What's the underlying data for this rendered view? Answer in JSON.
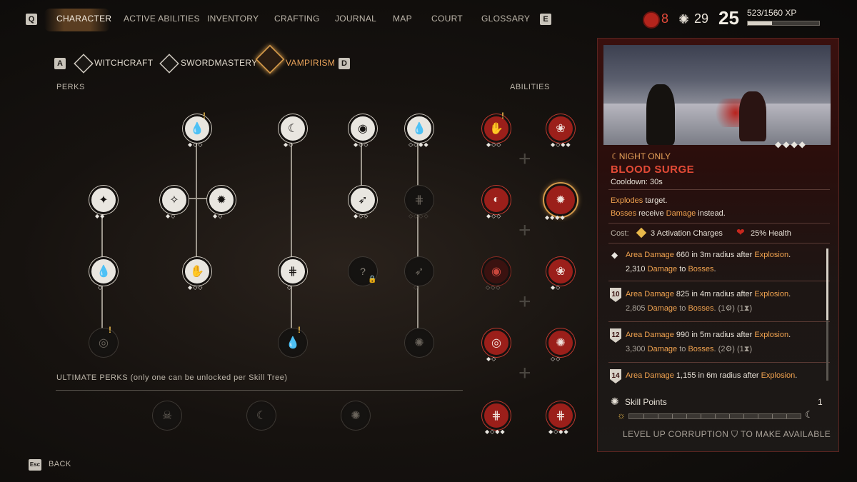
{
  "nav": {
    "left_key": "Q",
    "right_key": "E",
    "tabs": [
      {
        "label": "CHARACTER"
      },
      {
        "label": "ACTIVE ABILITIES"
      },
      {
        "label": "INVENTORY"
      },
      {
        "label": "CRAFTING"
      },
      {
        "label": "JOURNAL"
      },
      {
        "label": "MAP"
      },
      {
        "label": "COURT"
      },
      {
        "label": "GLOSSARY"
      }
    ],
    "active_tab": "CHARACTER"
  },
  "stats": {
    "blood": "8",
    "corruption": "29",
    "level": "25",
    "xp": "523/1560 XP",
    "xp_fraction": 0.335
  },
  "trees": {
    "left_key": "A",
    "right_key": "D",
    "tabs": [
      {
        "label": "WITCHCRAFT"
      },
      {
        "label": "SWORDMASTERY"
      },
      {
        "label": "VAMPIRISM"
      }
    ],
    "active_tab": "VAMPIRISM"
  },
  "sections": {
    "perks": "PERKS",
    "abilities": "ABILITIES",
    "ultimate": "ULTIMATE PERKS (only one can be unlocked per Skill Tree)"
  },
  "locked_glyph": "?",
  "detail": {
    "tag": "☾NIGHT ONLY",
    "title": "BLOOD SURGE",
    "cooldown": "Cooldown: 30s",
    "desc1_hl": "Explodes",
    "desc1_rest": " target.",
    "desc2_hl1": "Bosses",
    "desc2_mid": " receive ",
    "desc2_hl2": "Damage",
    "desc2_rest": " instead.",
    "cost_label": "Cost:",
    "cost1": "3 Activation Charges",
    "cost2": "25% Health",
    "ranks": [
      {
        "badge": "",
        "l1a": "Area Damage",
        "l1b": " 660 in 3m radius after ",
        "l1c": "Explosion",
        "l1d": ".",
        "l2a": "2,310 ",
        "l2b": "Damage",
        "l2c": " to ",
        "l2d": "Bosses",
        "l2e": "."
      },
      {
        "badge": "10",
        "l1a": "Area Damage",
        "l1b": " 825 in 4m radius after ",
        "l1c": "Explosion",
        "l1d": ".",
        "l2a": "2,805 ",
        "l2b": "Damage",
        "l2c": " to ",
        "l2d": "Bosses",
        "l2e": ". (1⚙) (1⧗)"
      },
      {
        "badge": "12",
        "l1a": "Area Damage",
        "l1b": " 990 in 5m radius after ",
        "l1c": "Explosion",
        "l1d": ".",
        "l2a": "3,300 ",
        "l2b": "Damage",
        "l2c": " to ",
        "l2d": "Bosses",
        "l2e": ". (2⚙) (1⧗)"
      },
      {
        "badge": "14",
        "l1a": "Area Damage",
        "l1b": " 1,155 in 6m radius after ",
        "l1c": "Explosion",
        "l1d": "."
      }
    ],
    "skill_points_label": "Skill Points",
    "skill_points_value": "1",
    "avail_prefix": "LEVEL UP CORRUPTION",
    "avail_suffix": "TO MAKE AVAILABLE"
  },
  "back": {
    "key": "Esc",
    "label": "BACK"
  }
}
